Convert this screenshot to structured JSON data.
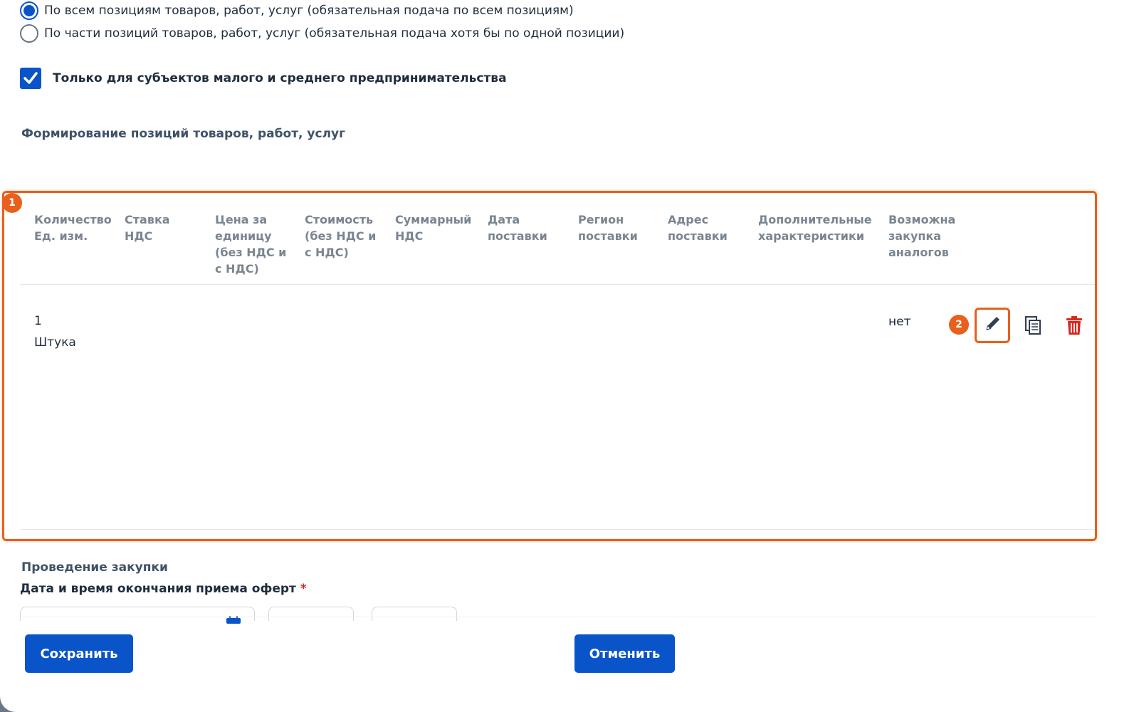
{
  "radio_options": [
    {
      "label": "По всем позициям товаров, работ, услуг (обязательная подача по всем позициям)",
      "checked": true
    },
    {
      "label": "По части позиций товаров, работ, услуг (обязательная подача хотя бы по одной позиции)",
      "checked": false
    }
  ],
  "sme_checkbox": {
    "label": "Только для субъектов малого и среднего предпринимательства",
    "checked": true
  },
  "positions_section": {
    "title": "Формирование позиций товаров, работ, услуг"
  },
  "badges": {
    "table": "1",
    "edit": "2"
  },
  "table": {
    "headers": [
      "Количество\nЕд. изм.",
      "Ставка\nНДС",
      "Цена за\nединицу\n(без НДС и\nс НДС)",
      "Стоимость\n(без НДС и\nс НДС)",
      "Суммарный\nНДС",
      "Дата\nпоставки",
      "Регион\nпоставки",
      "Адрес\nпоставки",
      "Дополнительные\nхарактеристики",
      "Возможна\nзакупка\nаналогов"
    ],
    "rows": [
      {
        "quantity": "1",
        "unit": "Штука",
        "analogs": "нет"
      }
    ],
    "row_actions": [
      "pencil-icon",
      "copy-icon",
      "trash-icon"
    ]
  },
  "procurement_section": {
    "title": "Проведение закупки"
  },
  "deadline_field": {
    "label": "Дата и время окончания приема оферт",
    "required_mark": "*"
  },
  "buttons": {
    "save": "Сохранить",
    "cancel": "Отменить"
  },
  "colors": {
    "accent": "#0a54c9",
    "highlight": "#e8601c",
    "danger": "#d9281e"
  }
}
